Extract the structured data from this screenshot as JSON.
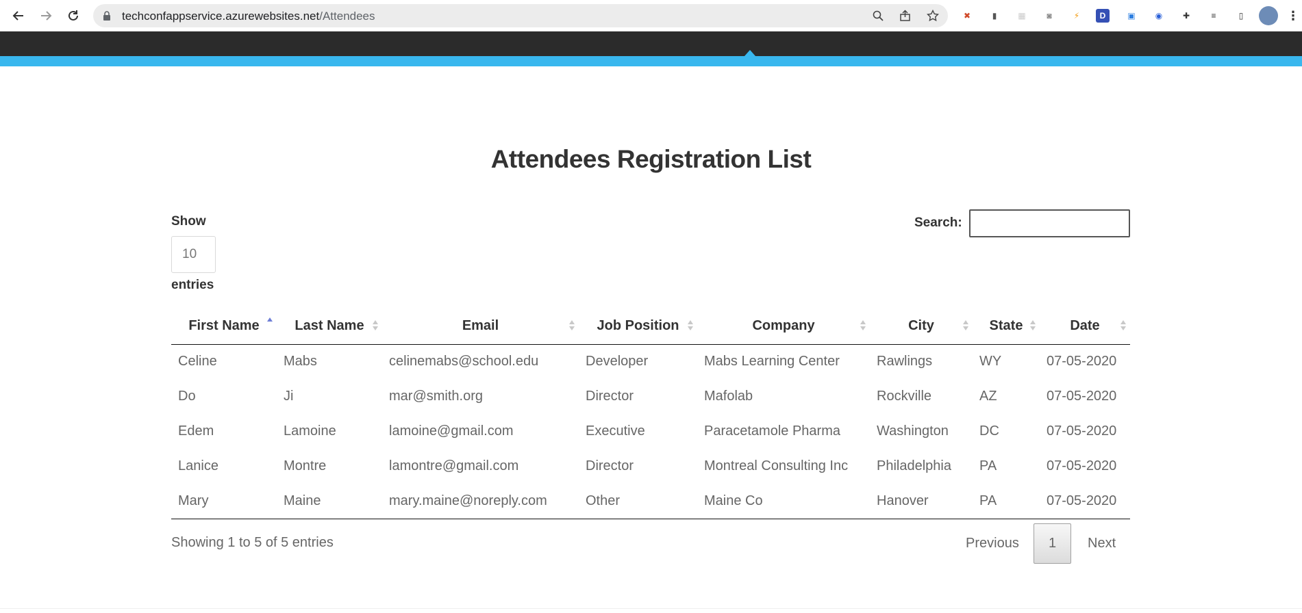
{
  "browser": {
    "url_host": "techconfappservice.azurewebsites.net",
    "url_path": "/Attendees",
    "extensions": [
      {
        "name": "puzzle-x-icon",
        "glyph": "✖",
        "color": "#d04a2a"
      },
      {
        "name": "phone-icon",
        "glyph": "▮",
        "color": "#555555"
      },
      {
        "name": "grid-icon",
        "glyph": "▦",
        "color": "#cccccc"
      },
      {
        "name": "camera-icon",
        "glyph": "◙",
        "color": "#888888"
      },
      {
        "name": "lightning-icon",
        "glyph": "⚡",
        "color": "#f39c12"
      },
      {
        "name": "d-letter-icon",
        "glyph": "D",
        "color": "#3550b5"
      },
      {
        "name": "window-icon",
        "glyph": "▣",
        "color": "#2d7fe0"
      },
      {
        "name": "circle-logo-icon",
        "glyph": "◉",
        "color": "#2a60d8"
      },
      {
        "name": "extensions-puzzle-icon",
        "glyph": "✚",
        "color": "#333333"
      },
      {
        "name": "playlist-icon",
        "glyph": "≡",
        "color": "#333333"
      },
      {
        "name": "sidebar-icon",
        "glyph": "▯",
        "color": "#333333"
      }
    ]
  },
  "colors": {
    "accent": "#39b7ee",
    "nav_bg": "#2b2b2b",
    "sort_active": "#6e7ed6"
  },
  "page": {
    "title": "Attendees Registration List"
  },
  "length_control": {
    "show_label": "Show",
    "value": "10",
    "entries_label": "entries"
  },
  "search": {
    "label": "Search:",
    "value": ""
  },
  "table": {
    "columns": [
      "First Name",
      "Last Name",
      "Email",
      "Job Position",
      "Company",
      "City",
      "State",
      "Date"
    ],
    "rows": [
      [
        "Celine",
        "Mabs",
        "celinemabs@school.edu",
        "Developer",
        "Mabs Learning Center",
        "Rawlings",
        "WY",
        "07-05-2020"
      ],
      [
        "Do",
        "Ji",
        "mar@smith.org",
        "Director",
        "Mafolab",
        "Rockville",
        "AZ",
        "07-05-2020"
      ],
      [
        "Edem",
        "Lamoine",
        "lamoine@gmail.com",
        "Executive",
        "Paracetamole Pharma",
        "Washington",
        "DC",
        "07-05-2020"
      ],
      [
        "Lanice",
        "Montre",
        "lamontre@gmail.com",
        "Director",
        "Montreal Consulting Inc",
        "Philadelphia",
        "PA",
        "07-05-2020"
      ],
      [
        "Mary",
        "Maine",
        "mary.maine@noreply.com",
        "Other",
        "Maine Co",
        "Hanover",
        "PA",
        "07-05-2020"
      ]
    ]
  },
  "footer": {
    "info": "Showing 1 to 5 of 5 entries",
    "previous": "Previous",
    "current_page": "1",
    "next": "Next"
  }
}
